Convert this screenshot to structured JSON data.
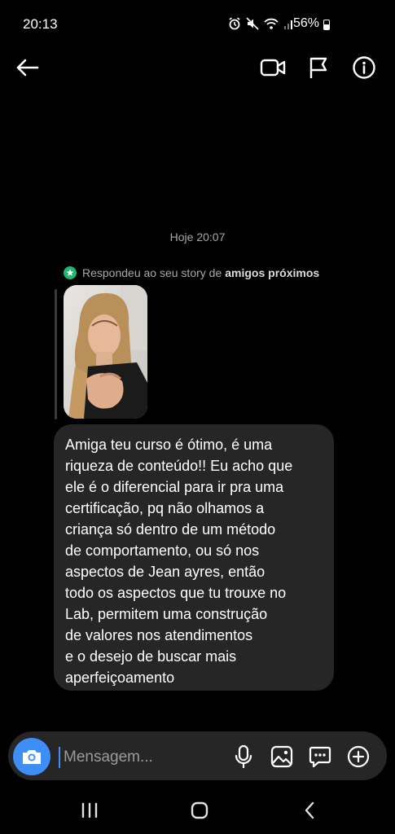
{
  "status_bar": {
    "time": "20:13",
    "battery": "56%"
  },
  "header": {
    "icons": [
      "back-arrow-icon",
      "video-call-icon",
      "flag-icon",
      "info-icon"
    ]
  },
  "chat": {
    "timestamp": "Hoje 20:07",
    "reply_context": {
      "text": "Respondeu ao seu story de",
      "bold": "amigos próximos"
    },
    "message_lines": [
      "Amiga teu curso é ótimo, é uma",
      "riqueza de conteúdo!! Eu acho que",
      "ele é o diferencial para ir pra uma",
      "certificação, pq não olhamos a",
      "criança só dentro de um método",
      "de comportamento, ou só nos",
      "aspectos de Jean ayres, então",
      "todo os aspectos que tu trouxe no",
      "Lab, permitem uma construção",
      "de valores nos atendimentos",
      "e o desejo de buscar mais",
      "aperfeiçoamento"
    ]
  },
  "composer": {
    "placeholder": "Mensagem..."
  },
  "colors": {
    "accent": "#3e8ef7",
    "bubble": "#262626",
    "close_friends_green": "#1fb86e"
  }
}
